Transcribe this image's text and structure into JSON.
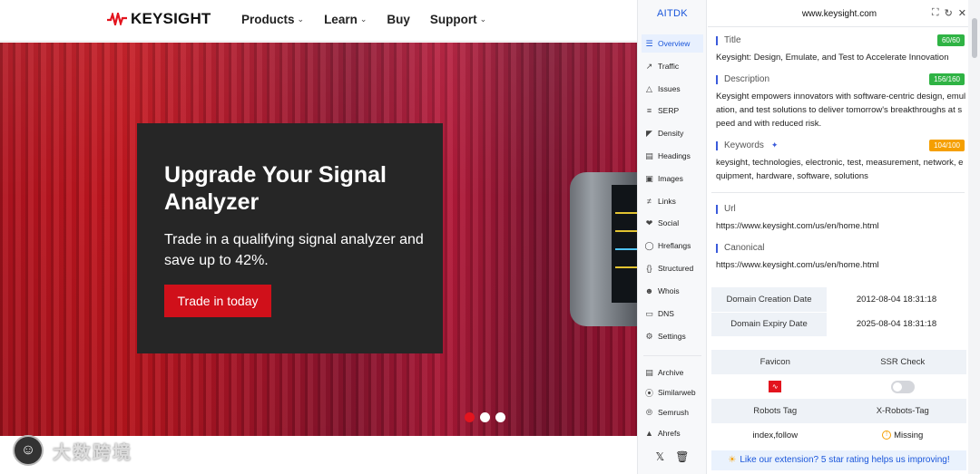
{
  "site": {
    "logo_text": "KEYSIGHT",
    "nav": [
      {
        "label": "Products",
        "chevron": true
      },
      {
        "label": "Learn",
        "chevron": true
      },
      {
        "label": "Buy",
        "chevron": false
      },
      {
        "label": "Support",
        "chevron": true
      }
    ],
    "hero": {
      "title": "Upgrade Your Signal Analyzer",
      "subtitle": "Trade in a qualifying signal analyzer and save up to 42%.",
      "cta": "Trade in today",
      "slides": 3,
      "active_slide": 0
    },
    "watermark_text": "大数跨境",
    "colors": {
      "brand_red": "#e3141e",
      "card_bg": "#262626"
    }
  },
  "extension": {
    "brand": "AITDK",
    "domain": "www.keysight.com",
    "sidebar": [
      {
        "label": "Overview",
        "icon": "list-icon",
        "active": true
      },
      {
        "label": "Traffic",
        "icon": "chart-icon"
      },
      {
        "label": "Issues",
        "icon": "warning-icon"
      },
      {
        "label": "SERP",
        "icon": "serp-icon"
      },
      {
        "label": "Density",
        "icon": "density-icon"
      },
      {
        "label": "Headings",
        "icon": "headings-icon"
      },
      {
        "label": "Images",
        "icon": "image-icon"
      },
      {
        "label": "Links",
        "icon": "links-icon"
      },
      {
        "label": "Social",
        "icon": "social-icon"
      },
      {
        "label": "Hreflangs",
        "icon": "globe-icon"
      },
      {
        "label": "Structured",
        "icon": "braces-icon"
      },
      {
        "label": "Whois",
        "icon": "user-icon"
      },
      {
        "label": "DNS",
        "icon": "dns-icon"
      },
      {
        "label": "Settings",
        "icon": "gear-icon"
      },
      {
        "label": "Archive",
        "icon": "archive-icon"
      },
      {
        "label": "Similarweb",
        "icon": "similarweb-icon"
      },
      {
        "label": "Semrush",
        "icon": "semrush-icon"
      },
      {
        "label": "Ahrefs",
        "icon": "ahrefs-icon"
      }
    ],
    "overview": {
      "title_label": "Title",
      "title_badge": "60/60",
      "title_value": "Keysight: Design, Emulate, and Test to Accelerate Innovation",
      "description_label": "Description",
      "description_badge": "156/160",
      "description_value": "Keysight empowers innovators with software-centric design, emulation, and test solutions to deliver tomorrow's breakthroughs at speed and with reduced risk.",
      "keywords_label": "Keywords",
      "keywords_badge": "104/100",
      "keywords_value": "keysight, technologies, electronic, test, measurement, network, equipment, hardware, software, solutions",
      "url_label": "Url",
      "url_value": "https://www.keysight.com/us/en/home.html",
      "canonical_label": "Canonical",
      "canonical_value": "https://www.keysight.com/us/en/home.html",
      "domain_creation_label": "Domain Creation Date",
      "domain_creation_value": "2012-08-04 18:31:18",
      "domain_expiry_label": "Domain Expiry Date",
      "domain_expiry_value": "2025-08-04 18:31:18",
      "favicon_label": "Favicon",
      "ssr_label": "SSR Check",
      "ssr_enabled": false,
      "robots_label": "Robots Tag",
      "robots_value": "index,follow",
      "xrobots_label": "X-Robots-Tag",
      "xrobots_value": "Missing"
    },
    "footer_text": "Like our extension? 5 star rating helps us improving!",
    "badge_colors": {
      "good": "#2fb344",
      "warn": "#f59f00"
    }
  }
}
